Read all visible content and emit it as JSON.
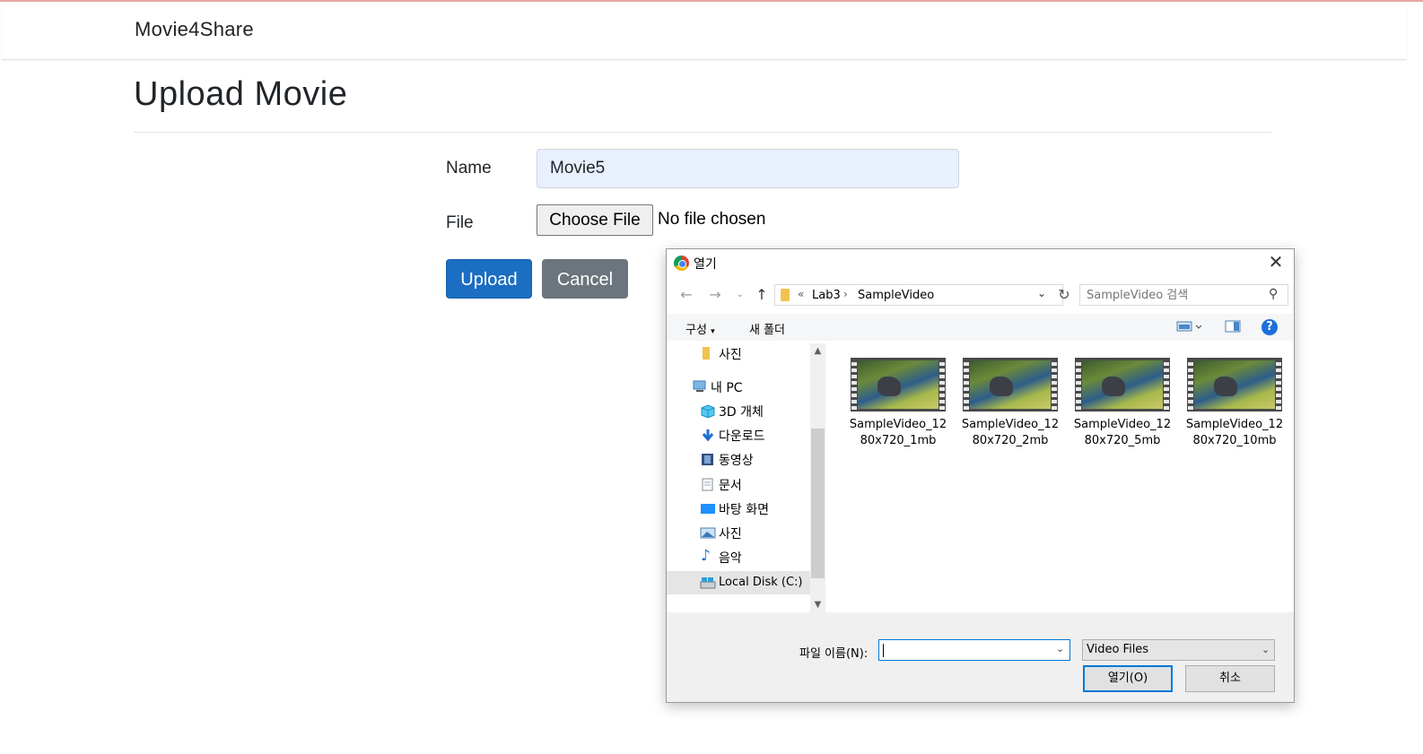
{
  "app": {
    "brand": "Movie4Share"
  },
  "page": {
    "title": "Upload Movie"
  },
  "form": {
    "name_label": "Name",
    "name_value": "Movie5",
    "file_label": "File",
    "choose_file_label": "Choose File",
    "file_status": "No file chosen",
    "upload_label": "Upload",
    "cancel_label": "Cancel"
  },
  "dialog": {
    "title": "열기",
    "breadcrumb": [
      "Lab3",
      "SampleVideo"
    ],
    "breadcrumb_overflow": "«",
    "search_placeholder": "SampleVideo 검색",
    "toolbar": {
      "organize": "구성",
      "new_folder": "새 폴더"
    },
    "tree": [
      {
        "label": "사진",
        "icon": "folder-icon"
      },
      {
        "label": "내 PC",
        "icon": "pc-icon"
      },
      {
        "label": "3D 개체",
        "icon": "cube-icon"
      },
      {
        "label": "다운로드",
        "icon": "download-icon"
      },
      {
        "label": "동영상",
        "icon": "video-icon"
      },
      {
        "label": "문서",
        "icon": "document-icon"
      },
      {
        "label": "바탕 화면",
        "icon": "desktop-icon"
      },
      {
        "label": "사진",
        "icon": "pictures-icon"
      },
      {
        "label": "음악",
        "icon": "music-icon"
      },
      {
        "label": "Local Disk (C:)",
        "icon": "disk-icon",
        "selected": true
      }
    ],
    "files": [
      {
        "line1": "SampleVideo_12",
        "line2": "80x720_1mb"
      },
      {
        "line1": "SampleVideo_12",
        "line2": "80x720_2mb"
      },
      {
        "line1": "SampleVideo_12",
        "line2": "80x720_5mb"
      },
      {
        "line1": "SampleVideo_12",
        "line2": "80x720_10mb"
      }
    ],
    "filename_label": "파일 이름(N):",
    "filename_value": "",
    "filetype": "Video Files",
    "open_label": "열기(O)",
    "cancel_label": "취소"
  },
  "colors": {
    "primary": "#1b6ec2",
    "secondary": "#6c757d",
    "autofill": "#e8f0fe",
    "win_accent": "#0078d7"
  }
}
